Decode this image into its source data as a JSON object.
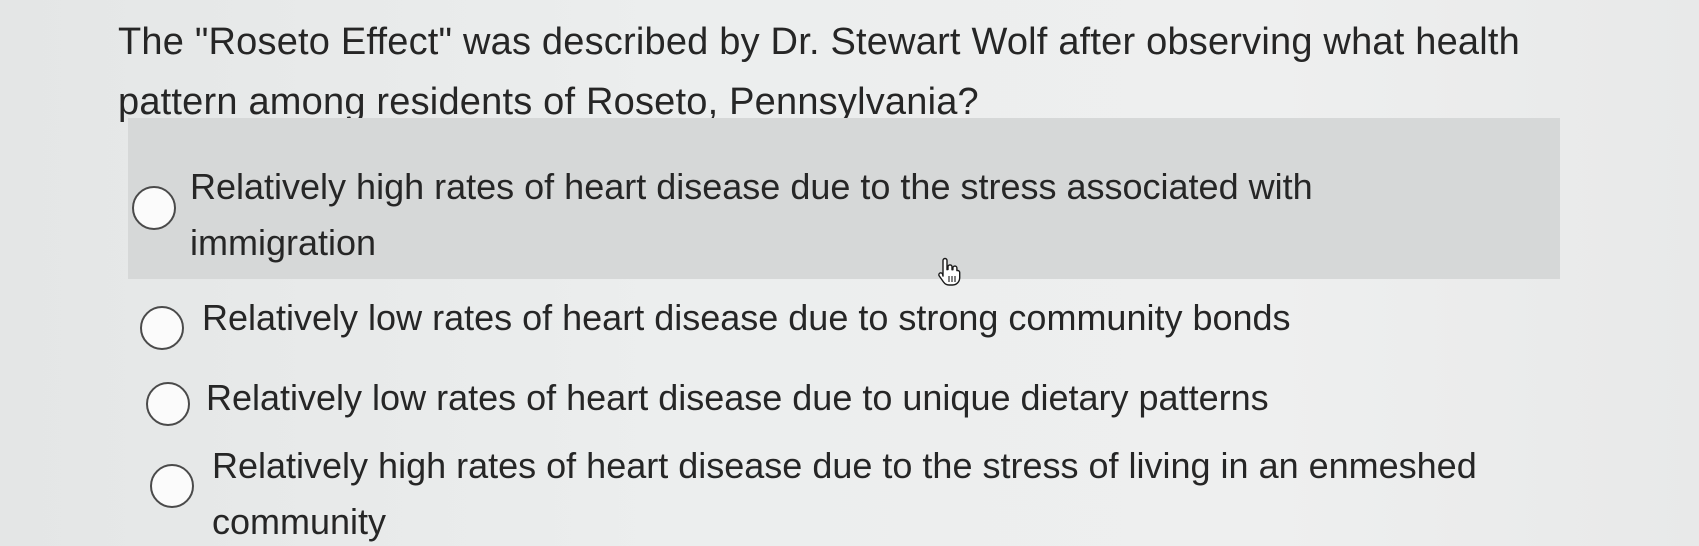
{
  "question": {
    "text": "The \"Roseto Effect\" was described by Dr. Stewart Wolf after observing what health pattern among residents of Roseto, Pennsylvania?"
  },
  "options": [
    {
      "label": "Relatively high rates of heart disease due to the stress associated with immigration",
      "selected": false,
      "highlighted": true
    },
    {
      "label": "Relatively low rates of heart disease due to strong community bonds",
      "selected": false,
      "highlighted": false
    },
    {
      "label": "Relatively low rates of heart disease due to unique dietary patterns",
      "selected": false,
      "highlighted": false
    },
    {
      "label": "Relatively high rates of heart disease due to the stress of living in an enmeshed community",
      "selected": false,
      "highlighted": false
    }
  ],
  "cursor": {
    "icon": "hand-pointer-icon"
  },
  "colors": {
    "background": "#eceeee",
    "highlight": "#d6d8d8",
    "text": "#262626"
  }
}
